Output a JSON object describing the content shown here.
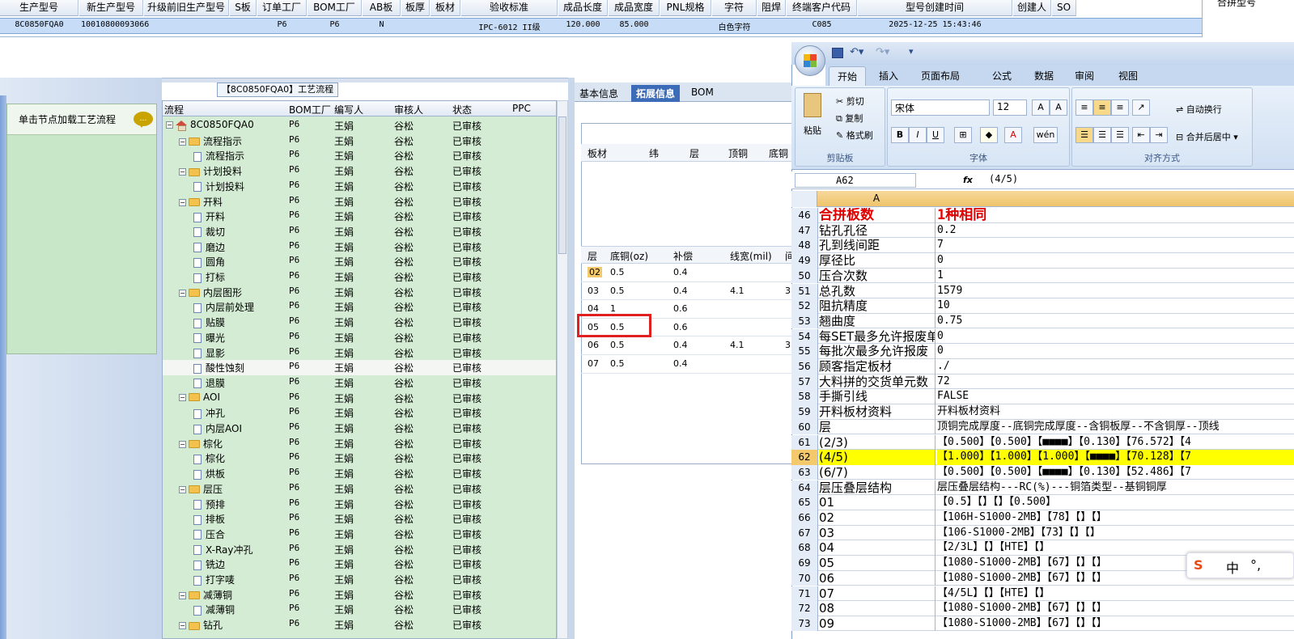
{
  "top_grid": {
    "headers": [
      "生产型号",
      "新生产型号",
      "升级前旧生产型号",
      "S板",
      "订单工厂",
      "BOM工厂",
      "AB板",
      "板厚",
      "板材",
      "验收标准",
      "成品长度",
      "成品宽度",
      "PNL规格",
      "字符",
      "阻焊",
      "终端客户代码",
      "型号创建时间",
      "创建人",
      "SO"
    ],
    "row": [
      "8C0850FQA0",
      "10010800093066",
      "",
      "",
      "P6",
      "P6",
      "N",
      "",
      "",
      "IPC-6012 II级",
      "120.000",
      "85.000",
      "",
      "白色字符",
      "",
      "C085",
      "2025-12-25 15:43:46",
      "",
      ""
    ],
    "right_header": "合拼型号"
  },
  "left_panel": {
    "load_hint": "单击节点加载工艺流程"
  },
  "process_title": "【8C0850FQA0】工艺流程",
  "tree": {
    "headers": [
      "流程",
      "BOM工厂",
      "编写人",
      "审核人",
      "状态",
      "PPC"
    ],
    "rows": [
      {
        "label": "8C0850FQA0",
        "icon": "home",
        "level": 0,
        "factory": "P6",
        "writer": "王娟",
        "reviewer": "谷松",
        "status": "已审核"
      },
      {
        "label": "流程指示",
        "icon": "folder",
        "level": 1,
        "factory": "P6",
        "writer": "王娟",
        "reviewer": "谷松",
        "status": "已审核"
      },
      {
        "label": "流程指示",
        "icon": "doc",
        "level": 2,
        "factory": "P6",
        "writer": "王娟",
        "reviewer": "谷松",
        "status": "已审核"
      },
      {
        "label": "计划投料",
        "icon": "folder",
        "level": 1,
        "factory": "P6",
        "writer": "王娟",
        "reviewer": "谷松",
        "status": "已审核"
      },
      {
        "label": "计划投料",
        "icon": "doc",
        "level": 2,
        "factory": "P6",
        "writer": "王娟",
        "reviewer": "谷松",
        "status": "已审核"
      },
      {
        "label": "开料",
        "icon": "folder",
        "level": 1,
        "factory": "P6",
        "writer": "王娟",
        "reviewer": "谷松",
        "status": "已审核"
      },
      {
        "label": "开料",
        "icon": "doc",
        "level": 2,
        "factory": "P6",
        "writer": "王娟",
        "reviewer": "谷松",
        "status": "已审核"
      },
      {
        "label": "裁切",
        "icon": "doc",
        "level": 2,
        "factory": "P6",
        "writer": "王娟",
        "reviewer": "谷松",
        "status": "已审核"
      },
      {
        "label": "磨边",
        "icon": "doc",
        "level": 2,
        "factory": "P6",
        "writer": "王娟",
        "reviewer": "谷松",
        "status": "已审核"
      },
      {
        "label": "圆角",
        "icon": "doc",
        "level": 2,
        "factory": "P6",
        "writer": "王娟",
        "reviewer": "谷松",
        "status": "已审核"
      },
      {
        "label": "打标",
        "icon": "doc",
        "level": 2,
        "factory": "P6",
        "writer": "王娟",
        "reviewer": "谷松",
        "status": "已审核"
      },
      {
        "label": "内层图形",
        "icon": "folder",
        "level": 1,
        "factory": "P6",
        "writer": "王娟",
        "reviewer": "谷松",
        "status": "已审核"
      },
      {
        "label": "内层前处理",
        "icon": "doc",
        "level": 2,
        "factory": "P6",
        "writer": "王娟",
        "reviewer": "谷松",
        "status": "已审核"
      },
      {
        "label": "贴膜",
        "icon": "doc",
        "level": 2,
        "factory": "P6",
        "writer": "王娟",
        "reviewer": "谷松",
        "status": "已审核"
      },
      {
        "label": "曝光",
        "icon": "doc",
        "level": 2,
        "factory": "P6",
        "writer": "王娟",
        "reviewer": "谷松",
        "status": "已审核"
      },
      {
        "label": "显影",
        "icon": "doc",
        "level": 2,
        "factory": "P6",
        "writer": "王娟",
        "reviewer": "谷松",
        "status": "已审核"
      },
      {
        "label": "酸性蚀刻",
        "icon": "doc",
        "level": 2,
        "factory": "P6",
        "writer": "王娟",
        "reviewer": "谷松",
        "status": "已审核",
        "selected": true
      },
      {
        "label": "退膜",
        "icon": "doc",
        "level": 2,
        "factory": "P6",
        "writer": "王娟",
        "reviewer": "谷松",
        "status": "已审核"
      },
      {
        "label": "AOI",
        "icon": "folder",
        "level": 1,
        "factory": "P6",
        "writer": "王娟",
        "reviewer": "谷松",
        "status": "已审核"
      },
      {
        "label": "冲孔",
        "icon": "doc",
        "level": 2,
        "factory": "P6",
        "writer": "王娟",
        "reviewer": "谷松",
        "status": "已审核"
      },
      {
        "label": "内层AOI",
        "icon": "doc",
        "level": 2,
        "factory": "P6",
        "writer": "王娟",
        "reviewer": "谷松",
        "status": "已审核"
      },
      {
        "label": "棕化",
        "icon": "folder",
        "level": 1,
        "factory": "P6",
        "writer": "王娟",
        "reviewer": "谷松",
        "status": "已审核"
      },
      {
        "label": "棕化",
        "icon": "doc",
        "level": 2,
        "factory": "P6",
        "writer": "王娟",
        "reviewer": "谷松",
        "status": "已审核"
      },
      {
        "label": "烘板",
        "icon": "doc",
        "level": 2,
        "factory": "P6",
        "writer": "王娟",
        "reviewer": "谷松",
        "status": "已审核"
      },
      {
        "label": "层压",
        "icon": "folder",
        "level": 1,
        "factory": "P6",
        "writer": "王娟",
        "reviewer": "谷松",
        "status": "已审核"
      },
      {
        "label": "预排",
        "icon": "doc",
        "level": 2,
        "factory": "P6",
        "writer": "王娟",
        "reviewer": "谷松",
        "status": "已审核"
      },
      {
        "label": "排板",
        "icon": "doc",
        "level": 2,
        "factory": "P6",
        "writer": "王娟",
        "reviewer": "谷松",
        "status": "已审核"
      },
      {
        "label": "压合",
        "icon": "doc",
        "level": 2,
        "factory": "P6",
        "writer": "王娟",
        "reviewer": "谷松",
        "status": "已审核"
      },
      {
        "label": "X-Ray冲孔",
        "icon": "doc",
        "level": 2,
        "factory": "P6",
        "writer": "王娟",
        "reviewer": "谷松",
        "status": "已审核"
      },
      {
        "label": "铣边",
        "icon": "doc",
        "level": 2,
        "factory": "P6",
        "writer": "王娟",
        "reviewer": "谷松",
        "status": "已审核"
      },
      {
        "label": "打字唛",
        "icon": "doc",
        "level": 2,
        "factory": "P6",
        "writer": "王娟",
        "reviewer": "谷松",
        "status": "已审核"
      },
      {
        "label": "减薄铜",
        "icon": "folder",
        "level": 1,
        "factory": "P6",
        "writer": "王娟",
        "reviewer": "谷松",
        "status": "已审核"
      },
      {
        "label": "减薄铜",
        "icon": "doc",
        "level": 2,
        "factory": "P6",
        "writer": "王娟",
        "reviewer": "谷松",
        "status": "已审核"
      },
      {
        "label": "钻孔",
        "icon": "folder",
        "level": 1,
        "factory": "P6",
        "writer": "王娟",
        "reviewer": "谷松",
        "status": "已审核"
      }
    ]
  },
  "mid_panel": {
    "tabs": [
      "基本信息",
      "拓展信息",
      "BOM"
    ],
    "header1": [
      "板材",
      "纬",
      "层",
      "顶铜",
      "底铜"
    ],
    "header2": [
      "层",
      "底铜(oz)",
      "补偿",
      "线宽(mil)",
      "间"
    ],
    "rows": [
      [
        "02",
        "0.5",
        "0.4",
        "",
        ""
      ],
      [
        "03",
        "0.5",
        "0.4",
        "4.1",
        "3."
      ],
      [
        "04",
        "1",
        "0.6",
        "",
        ""
      ],
      [
        "05",
        "0.5",
        "0.6",
        "",
        ""
      ],
      [
        "06",
        "0.5",
        "0.4",
        "4.1",
        "3."
      ],
      [
        "07",
        "0.5",
        "0.4",
        "",
        ""
      ]
    ]
  },
  "excel": {
    "tabs": [
      "开始",
      "插入",
      "页面布局",
      "公式",
      "数据",
      "审阅",
      "视图"
    ],
    "clipboard": {
      "paste": "粘贴",
      "cut": "剪切",
      "copy": "复制",
      "format_painter": "格式刷",
      "group": "剪贴板"
    },
    "font": {
      "name": "宋体",
      "size": "12",
      "group": "字体"
    },
    "align": {
      "wrap": "自动换行",
      "merge": "合并后居中",
      "group": "对齐方式"
    },
    "name_box": "A62",
    "formula": "(4/5)",
    "col_a": "A",
    "rows": [
      {
        "n": "46",
        "a": "合拼板数",
        "b": "1种相同",
        "big": true
      },
      {
        "n": "47",
        "a": "钻孔孔径",
        "b": "0.2"
      },
      {
        "n": "48",
        "a": "孔到线间距",
        "b": "7"
      },
      {
        "n": "49",
        "a": "厚径比",
        "b": "0"
      },
      {
        "n": "50",
        "a": "压合次数",
        "b": "1"
      },
      {
        "n": "51",
        "a": "总孔数",
        "b": "1579"
      },
      {
        "n": "52",
        "a": "阻抗精度",
        "b": "10"
      },
      {
        "n": "53",
        "a": "翘曲度",
        "b": "0.75"
      },
      {
        "n": "54",
        "a": "每SET最多允许报废单",
        "b": "0"
      },
      {
        "n": "55",
        "a": "每批次最多允许报废",
        "b": "0"
      },
      {
        "n": "56",
        "a": "顾客指定板材",
        "b": "./"
      },
      {
        "n": "57",
        "a": "大料拼的交货单元数",
        "b": "72"
      },
      {
        "n": "58",
        "a": "手撕引线",
        "b": "FALSE"
      },
      {
        "n": "59",
        "a": "开料板材资料",
        "b": "开料板材资料"
      },
      {
        "n": "60",
        "a": "层",
        "b": "顶铜完成厚度--底铜完成厚度--含铜板厚--不含铜厚--顶线"
      },
      {
        "n": "61",
        "a": "(2/3)",
        "b": "【0.500】【0.500】【■■■■】【0.130】【76.572】【4"
      },
      {
        "n": "62",
        "a": "(4/5)",
        "b": "【1.000】【1.000】【1.000】【■■■■】【70.128】【7",
        "hl": true
      },
      {
        "n": "63",
        "a": "(6/7)",
        "b": "【0.500】【0.500】【■■■■】【0.130】【52.486】【7"
      },
      {
        "n": "64",
        "a": "层压叠层结构",
        "b": "层压叠层结构---RC(%)---铜箔类型--基铜铜厚"
      },
      {
        "n": "65",
        "a": "01",
        "b": "【0.5】【】【】【0.500】"
      },
      {
        "n": "66",
        "a": "02",
        "b": "【106H-S1000-2MB】【78】【】【】"
      },
      {
        "n": "67",
        "a": "03",
        "b": "【106-S1000-2MB】【73】【】【】"
      },
      {
        "n": "68",
        "a": "04",
        "b": "【2/3L】【】【HTE】【】"
      },
      {
        "n": "69",
        "a": "05",
        "b": "【1080-S1000-2MB】【67】【】【】"
      },
      {
        "n": "70",
        "a": "06",
        "b": "【1080-S1000-2MB】【67】【】【】"
      },
      {
        "n": "71",
        "a": "07",
        "b": "【4/5L】【】【HTE】【】"
      },
      {
        "n": "72",
        "a": "08",
        "b": "【1080-S1000-2MB】【67】【】【】"
      },
      {
        "n": "73",
        "a": "09",
        "b": "【1080-S1000-2MB】【67】【】【】"
      }
    ]
  },
  "ime": {
    "logo": "S",
    "mode": "中",
    "punct": "°,"
  }
}
